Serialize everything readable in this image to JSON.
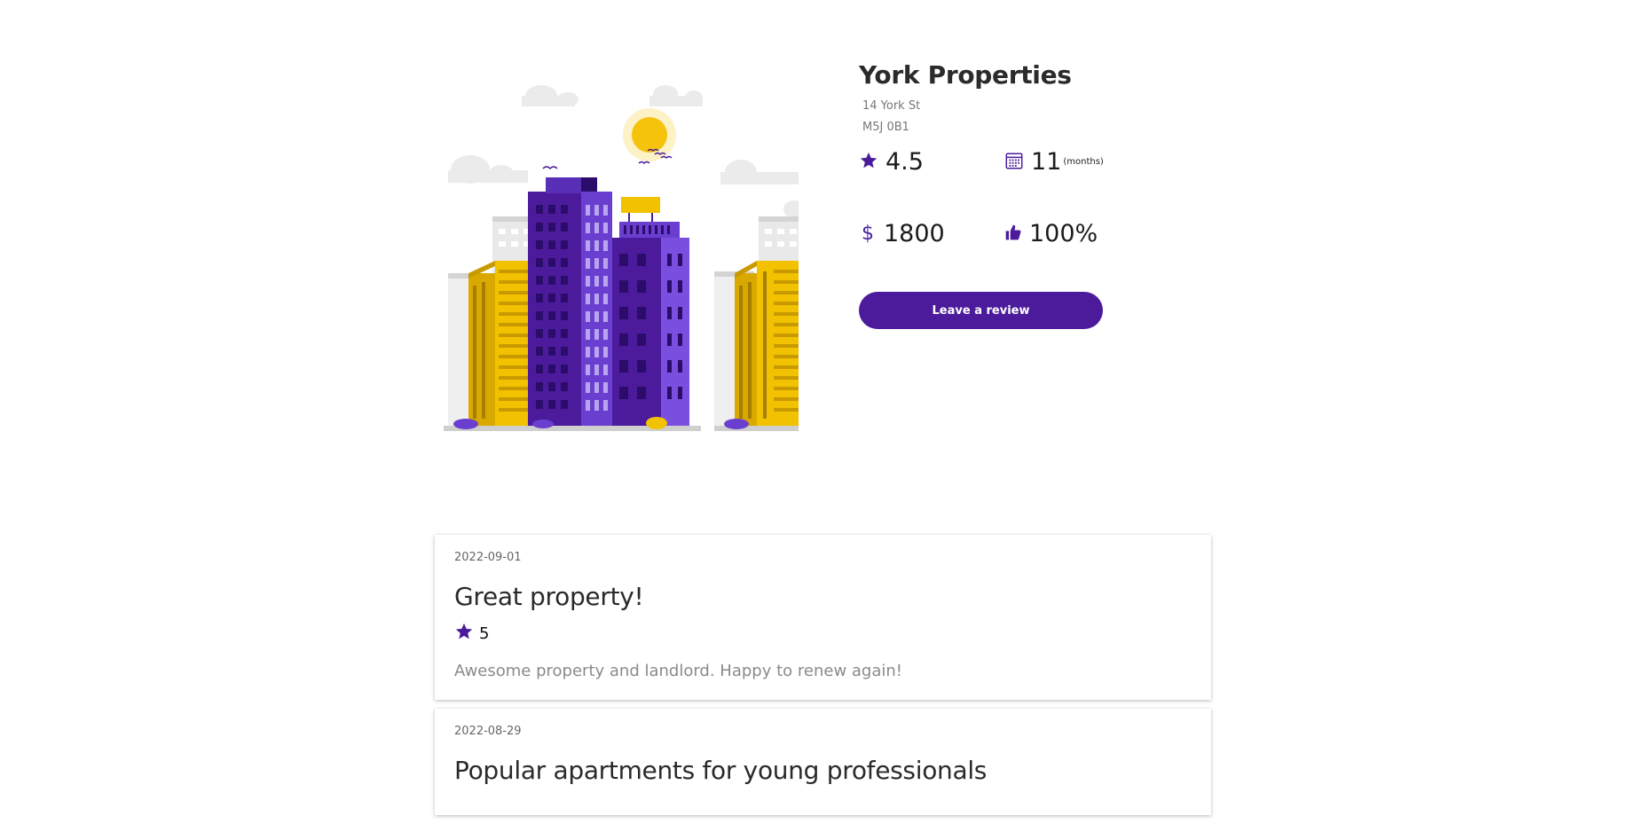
{
  "property": {
    "name": "York Properties",
    "address_line1": "14 York St",
    "address_line2": "M5J 0B1",
    "rating": "4.5",
    "lease_length": "11",
    "lease_unit": "(months)",
    "currency_symbol": "$",
    "rent": "1800",
    "recommend": "100%",
    "review_button_label": "Leave a review"
  },
  "icons": {
    "rating": "star-icon",
    "lease": "calendar-icon",
    "rent": "dollar-icon",
    "recommend": "thumbs-up-icon"
  },
  "colors": {
    "accent": "#4b1b9c",
    "building_yellow": "#f2c200",
    "building_purple": "#5a2fb8"
  },
  "reviews": [
    {
      "date": "2022-09-01",
      "title": "Great property!",
      "rating": "5",
      "body": "Awesome property and landlord. Happy to renew again!"
    },
    {
      "date": "2022-08-29",
      "title": "Popular apartments for young professionals",
      "rating": "",
      "body": ""
    }
  ]
}
